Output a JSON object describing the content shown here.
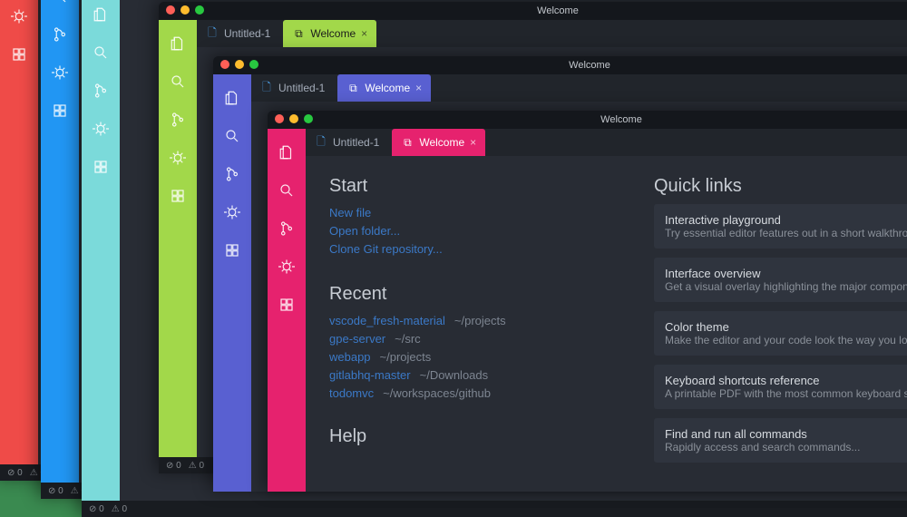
{
  "titlebar": "Welcome",
  "tabs": {
    "untitled": "Untitled-1",
    "welcome": "Welcome"
  },
  "start": {
    "heading": "Start",
    "new_file": "New file",
    "open_folder": "Open folder...",
    "clone": "Clone Git repository..."
  },
  "recent": {
    "heading": "Recent",
    "items": [
      {
        "name": "vscode_fresh-material",
        "path": "~/projects"
      },
      {
        "name": "gpe-server",
        "path": "~/src"
      },
      {
        "name": "webapp",
        "path": "~/projects"
      },
      {
        "name": "gitlabhq-master",
        "path": "~/Downloads"
      },
      {
        "name": "todomvc",
        "path": "~/workspaces/github"
      }
    ]
  },
  "help": {
    "heading": "Help"
  },
  "quicklinks": {
    "heading": "Quick links",
    "items": [
      {
        "t": "Interactive playground",
        "d": "Try essential editor features out in a short walkthrou..."
      },
      {
        "t": "Interface overview",
        "d": "Get a visual overlay highlighting the major componen..."
      },
      {
        "t": "Color theme",
        "d": "Make the editor and your code look the way you love"
      },
      {
        "t": "Keyboard shortcuts reference",
        "d": "A printable PDF with the most common keyboard sho..."
      },
      {
        "t": "Find and run all commands",
        "d": "Rapidly access and search commands..."
      }
    ]
  },
  "themes": [
    "red",
    "blue",
    "cyan",
    "green",
    "indigo",
    "pink"
  ]
}
